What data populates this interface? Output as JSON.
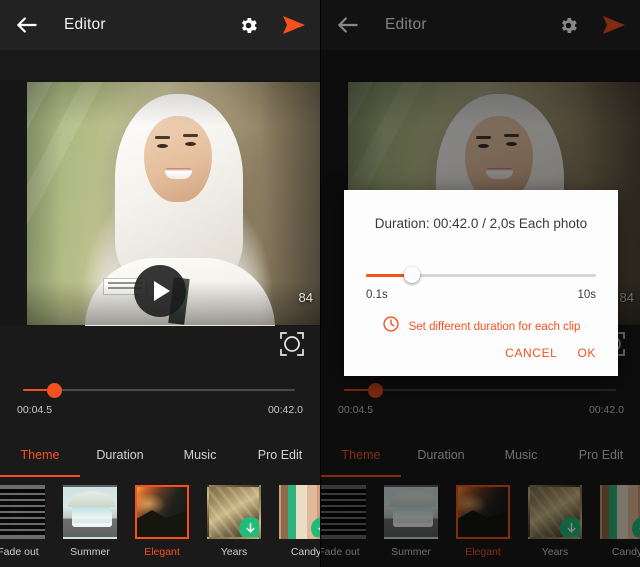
{
  "appbar": {
    "title": "Editor",
    "back_icon": "arrow-left-icon",
    "settings_icon": "gear-icon",
    "send_icon": "send-icon"
  },
  "preview": {
    "frame_count": "84",
    "play_icon": "play-icon"
  },
  "timeline": {
    "crop_icon": "fullscreen-crop-icon",
    "current_time": "00:04.5",
    "total_time": "00:42.0",
    "progress_percent": 11
  },
  "tabs": [
    {
      "label": "Theme",
      "active": true
    },
    {
      "label": "Duration",
      "active": false
    },
    {
      "label": "Music",
      "active": false
    },
    {
      "label": "Pro Edit",
      "active": false
    }
  ],
  "themes": [
    {
      "label": "Fade out",
      "selected": false,
      "downloadable": false
    },
    {
      "label": "Summer",
      "selected": false,
      "downloadable": false
    },
    {
      "label": "Elegant",
      "selected": true,
      "downloadable": false
    },
    {
      "label": "Years",
      "selected": false,
      "downloadable": true
    },
    {
      "label": "Candy",
      "selected": false,
      "downloadable": true
    }
  ],
  "dialog": {
    "title": "Duration: 00:42.0 / 2,0s Each photo",
    "slider_min_label": "0.1s",
    "slider_max_label": "10s",
    "slider_percent": 22,
    "clock_icon": "clock-icon",
    "link_label": "Set different duration for each clip",
    "cancel_label": "CANCEL",
    "ok_label": "OK"
  },
  "colors": {
    "accent": "#f4511e",
    "download_badge": "#22bb77",
    "appbar_bg": "#232222",
    "panel_bg": "#1b1a1a"
  }
}
